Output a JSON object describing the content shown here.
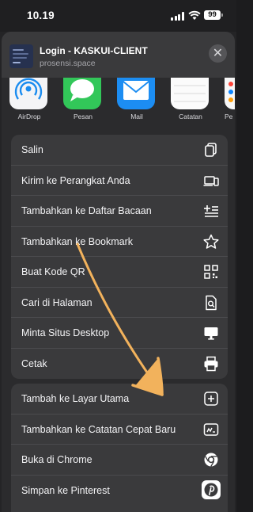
{
  "status_bar": {
    "time": "10.19",
    "battery": "99"
  },
  "share_header": {
    "title": "Login - KASKUI-CLIENT",
    "subtitle": "prosensi.space",
    "close_glyph": "✕"
  },
  "apps": [
    {
      "label": "AirDrop",
      "icon": "airdrop-icon"
    },
    {
      "label": "Pesan",
      "icon": "messages-icon"
    },
    {
      "label": "Mail",
      "icon": "mail-icon"
    },
    {
      "label": "Catatan",
      "icon": "notes-icon"
    },
    {
      "label": "Pe",
      "icon": "reminders-icon"
    }
  ],
  "actions_group_1": [
    {
      "label": "Salin",
      "icon": "copy-icon"
    },
    {
      "label": "Kirim ke Perangkat Anda",
      "icon": "devices-icon"
    },
    {
      "label": "Tambahkan ke Daftar Bacaan",
      "icon": "reading-list-icon"
    },
    {
      "label": "Tambahkan ke Bookmark",
      "icon": "star-icon"
    },
    {
      "label": "Buat Kode QR",
      "icon": "qr-code-icon"
    },
    {
      "label": "Cari di Halaman",
      "icon": "find-in-page-icon"
    },
    {
      "label": "Minta Situs Desktop",
      "icon": "desktop-icon"
    },
    {
      "label": "Cetak",
      "icon": "printer-icon"
    }
  ],
  "actions_group_2": [
    {
      "label": "Tambah ke Layar Utama",
      "icon": "add-square-icon"
    },
    {
      "label": "Tambahkan ke Catatan Cepat Baru",
      "icon": "quick-note-icon"
    },
    {
      "label": "Buka di Chrome",
      "icon": "chrome-icon"
    },
    {
      "label": "Simpan ke Pinterest",
      "icon": "pinterest-icon"
    }
  ],
  "colors": {
    "accent_arrow": "#f2b25c",
    "sheet_bg": "#2b2b2d",
    "row_bg": "#3a3a3c"
  }
}
